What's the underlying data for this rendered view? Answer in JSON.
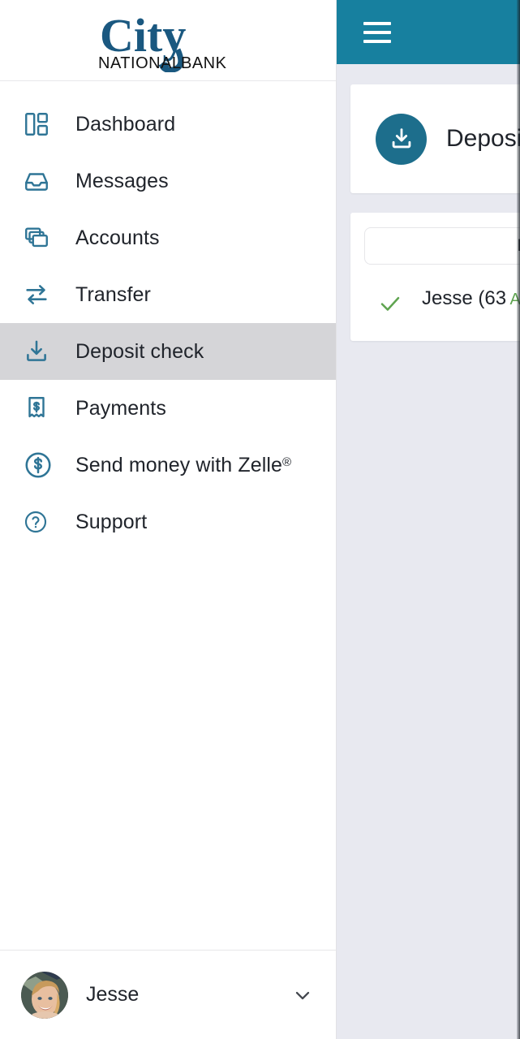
{
  "brand": {
    "name_primary": "City",
    "name_secondary_left": "NATIONAL",
    "name_secondary_right": "BANK",
    "color_primary": "#1a5880",
    "color_secondary": "#111111"
  },
  "sidebar": {
    "items": [
      {
        "label": "Dashboard",
        "icon": "dashboard-grid-icon",
        "active": false
      },
      {
        "label": "Messages",
        "icon": "inbox-tray-icon",
        "active": false
      },
      {
        "label": "Accounts",
        "icon": "stacked-cards-icon",
        "active": false
      },
      {
        "label": "Transfer",
        "icon": "swap-arrows-icon",
        "active": false
      },
      {
        "label": "Deposit check",
        "icon": "download-tray-icon",
        "active": true
      },
      {
        "label": "Payments",
        "icon": "receipt-dollar-icon",
        "active": false
      },
      {
        "label": "Send money with Zelle",
        "icon": "circle-dollar-icon",
        "active": false,
        "superscript": "®"
      },
      {
        "label": "Support",
        "icon": "question-circle-icon",
        "active": false
      }
    ],
    "active_highlight_color": "#d5d5d8",
    "icon_color": "#2f7596"
  },
  "user": {
    "name": "Jesse",
    "avatar": "user-photo-avatar",
    "caret": "chevron-down-icon"
  },
  "topbar": {
    "menu_icon": "hamburger-menu-icon",
    "background_color": "#17809f"
  },
  "main": {
    "background_color": "#e8e9f0",
    "deposit_card": {
      "icon": "download-circle-icon",
      "title": "Deposit check",
      "badge_color": "#1d6e8c"
    },
    "activity_card": {
      "tab_label": "Recent activity",
      "rows": [
        {
          "icon": "green-check-icon",
          "title": "Jesse (63",
          "status": "Accepted",
          "status_color": "#5fa450"
        }
      ]
    }
  }
}
